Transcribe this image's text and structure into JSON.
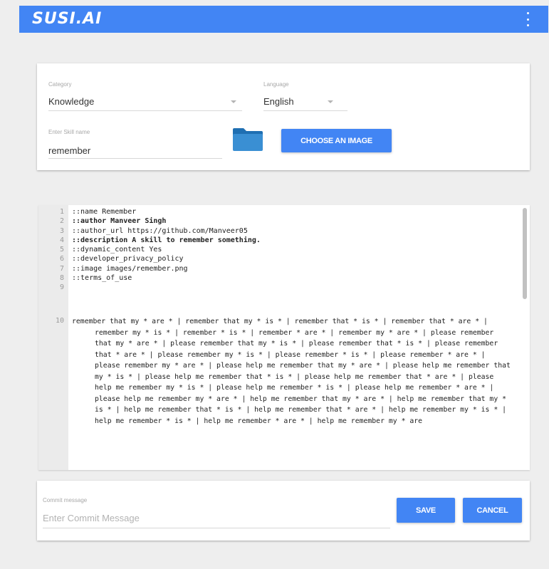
{
  "app": {
    "logo_text": "SUSI.AI",
    "brand_color": "#4285f4",
    "menu_icon": "more-vert-icon"
  },
  "form": {
    "category": {
      "label": "Category",
      "value": "Knowledge"
    },
    "language": {
      "label": "Language",
      "value": "English"
    },
    "expert_name": {
      "label": "Enter Skill name",
      "value": "remember"
    },
    "folder_icon": "folder-icon",
    "choose_image_label": "CHOOSE AN IMAGE"
  },
  "editor": {
    "lines": [
      {
        "n": "1",
        "text": "::name Remember",
        "bold": false
      },
      {
        "n": "2",
        "text": "::author Manveer Singh",
        "bold": true
      },
      {
        "n": "3",
        "text": "::author_url https://github.com/Manveer05",
        "bold": false
      },
      {
        "n": "4",
        "text": "::description A skill to remember something.",
        "bold": true
      },
      {
        "n": "5",
        "text": "::dynamic_content Yes",
        "bold": false
      },
      {
        "n": "6",
        "text": "::developer_privacy_policy",
        "bold": false
      },
      {
        "n": "7",
        "text": "::image images/remember.png",
        "bold": false
      },
      {
        "n": "8",
        "text": "::terms_of_use",
        "bold": false
      },
      {
        "n": "9",
        "text": "",
        "bold": false
      }
    ],
    "line10_number": "10",
    "line10_text": "remember that my * are * | remember that my * is * | remember that * is * | remember that * are * | remember my * is * | remember * is * | remember * are * | remember my * are * | please remember that my * are * | please remember that my * is * | please remember that * is * | please remember that * are * | please remember my * is * | please remember * is * | please remember * are * | please remember my * are * | please help me remember that my * are * | please help me remember that my * is * | please help me remember that * is * | please help me remember that * are * | please help me remember my * is * | please help me remember * is * | please help me remember * are * | please help me remember my * are * | help me remember that my * are * | help me remember that my * is * | help me remember that * is * | help me remember that * are * | help me remember my * is * | help me remember * is * | help me remember * are * | help me remember my * are"
  },
  "commit": {
    "label": "Commit message",
    "placeholder": "Enter Commit Message",
    "save_label": "SAVE",
    "cancel_label": "CANCEL"
  }
}
